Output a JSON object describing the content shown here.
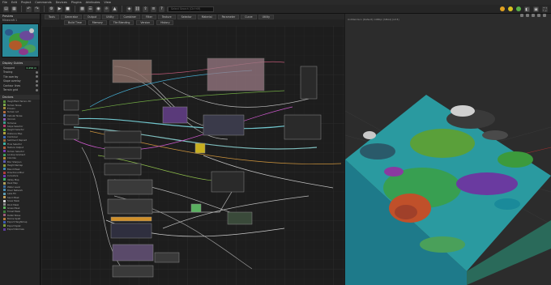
{
  "menu": [
    "File",
    "Edit",
    "Project",
    "Commands",
    "Devices",
    "Plugins",
    "Attributes",
    "View"
  ],
  "search": {
    "placeholder": "Select Search (Ctrl+M)"
  },
  "toolbar": {
    "icons": [
      "open-icon",
      "save-icon",
      "undo-icon",
      "redo-icon",
      "build-icon",
      "play-icon"
    ],
    "status_dots": [
      "#e0a020",
      "#d8c020",
      "#58b048"
    ]
  },
  "graph": {
    "tabs": [
      "Tools",
      "Generator",
      "Output",
      "Utility",
      "Combiner",
      "Filter",
      "Texture",
      "Selector",
      "Material",
      "Parameter",
      "Curve",
      "Utility"
    ],
    "buttons": [
      "Build Time",
      "Memory",
      "Tile Blending",
      "Version",
      "History"
    ]
  },
  "left": {
    "preview_title": "Preview",
    "preview_sub": "Minecraft 1",
    "guides_title": "Display Guides",
    "guides": [
      {
        "label": "Snapped",
        "value": "0.256 m"
      },
      {
        "label": "Tracing",
        "value": ""
      },
      {
        "label": "Tile overlay",
        "value": ""
      },
      {
        "label": "Slope overlay",
        "value": ""
      },
      {
        "label": "Contour lines",
        "value": ""
      },
      {
        "label": "Terrain grid",
        "value": ""
      }
    ],
    "devices_title": "Devices",
    "devices": [
      {
        "label": "Heightfield Terrain 3D",
        "color": "#5a8f3c"
      },
      {
        "label": "Terrain Noise",
        "color": "#7aa64a"
      },
      {
        "label": "Erosion",
        "color": "#a08a3c"
      },
      {
        "label": "Terrain Lot",
        "color": "#b06a3c"
      },
      {
        "label": "Cellular Noise",
        "color": "#5c7ab0"
      },
      {
        "label": "Voronoi",
        "color": "#8a5cb0"
      },
      {
        "label": "Terraces",
        "color": "#3c9a8a"
      },
      {
        "label": "Slope Selector",
        "color": "#b03c6a"
      },
      {
        "label": "Height Selector",
        "color": "#6ab03c"
      },
      {
        "label": "Distance Map",
        "color": "#b0a03c"
      },
      {
        "label": "Combiner",
        "color": "#3c6ab0"
      },
      {
        "label": "Sediment Deposit",
        "color": "#9a6a3c"
      },
      {
        "label": "Flow Selector",
        "color": "#3cb0a0"
      },
      {
        "label": "Texture Output",
        "color": "#b05c3c"
      },
      {
        "label": "Terrain Selector",
        "color": "#7a3cb0"
      },
      {
        "label": "Lookup Gradient",
        "color": "#3c9a5c"
      },
      {
        "label": "Colorize",
        "color": "#b0883c"
      },
      {
        "label": "Blur Sharpen",
        "color": "#5c5cb0"
      },
      {
        "label": "Height Remap",
        "color": "#8a9a3c"
      },
      {
        "label": "Blend Mask",
        "color": "#3c8ab0"
      },
      {
        "label": "Directional Blur",
        "color": "#b03c3c"
      },
      {
        "label": "Curvature",
        "color": "#6a3cb0"
      },
      {
        "label": "Valley Map",
        "color": "#3cb06a"
      },
      {
        "label": "Peak Map",
        "color": "#b0a05c"
      },
      {
        "label": "Water Level",
        "color": "#3c6a9a"
      },
      {
        "label": "River Network",
        "color": "#4a8ab0"
      },
      {
        "label": "Lake Fill",
        "color": "#5c9ab0"
      },
      {
        "label": "Sand Mask",
        "color": "#c0a05c"
      },
      {
        "label": "Snow Mask",
        "color": "#d0d0d0"
      },
      {
        "label": "Rock Mask",
        "color": "#8a8a8a"
      },
      {
        "label": "Grass Mask",
        "color": "#5cb05c"
      },
      {
        "label": "Forest Mask",
        "color": "#3c7a3c"
      },
      {
        "label": "Detail Noise",
        "color": "#9a5c7a"
      },
      {
        "label": "Biome Splat",
        "color": "#b07a3c"
      },
      {
        "label": "Export Heightmap",
        "color": "#3c5cb0"
      },
      {
        "label": "Export Splat",
        "color": "#7a9a3c"
      },
      {
        "label": "Export Normals",
        "color": "#5c3c9a"
      }
    ]
  },
  "viewport": {
    "title": "Untitled.tscn [Default] (1080p) [SMAA] [Lit 8]"
  }
}
